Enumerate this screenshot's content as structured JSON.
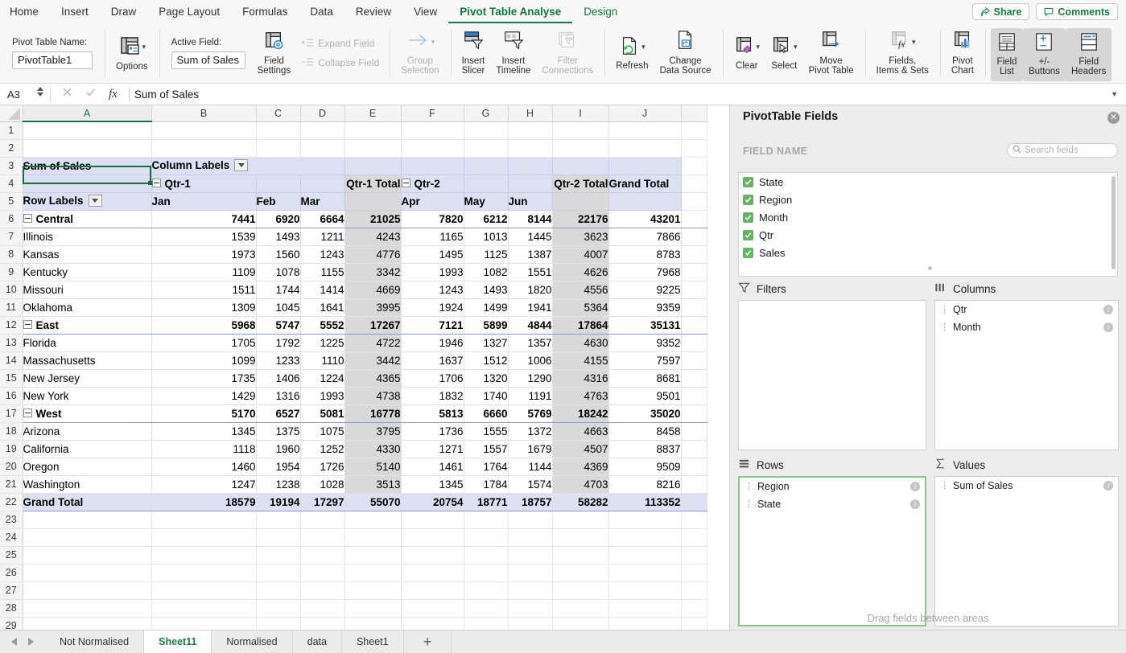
{
  "ribbon": {
    "tabs": [
      {
        "label": "Home",
        "active": false
      },
      {
        "label": "Insert",
        "active": false
      },
      {
        "label": "Draw",
        "active": false
      },
      {
        "label": "Page Layout",
        "active": false
      },
      {
        "label": "Formulas",
        "active": false
      },
      {
        "label": "Data",
        "active": false
      },
      {
        "label": "Review",
        "active": false
      },
      {
        "label": "View",
        "active": false
      },
      {
        "label": "Pivot Table Analyse",
        "active": true
      },
      {
        "label": "Design",
        "active": false
      }
    ],
    "share_label": "Share",
    "comments_label": "Comments",
    "pivot_table_name_label": "Pivot Table Name:",
    "pivot_table_name_value": "PivotTable1",
    "options_label": "Options",
    "active_field_label": "Active Field:",
    "active_field_value": "Sum of Sales",
    "field_settings_label_1": "Field",
    "field_settings_label_2": "Settings",
    "expand_field_label": "Expand Field",
    "collapse_field_label": "Collapse Field",
    "group_selection_label_1": "Group",
    "group_selection_label_2": "Selection",
    "insert_slicer_label_1": "Insert",
    "insert_slicer_label_2": "Slicer",
    "insert_timeline_label_1": "Insert",
    "insert_timeline_label_2": "Timeline",
    "filter_connections_label_1": "Filter",
    "filter_connections_label_2": "Connections",
    "refresh_label": "Refresh",
    "change_data_source_label_1": "Change",
    "change_data_source_label_2": "Data Source",
    "clear_label": "Clear",
    "select_label": "Select",
    "move_pivot_label_1": "Move",
    "move_pivot_label_2": "Pivot Table",
    "fields_items_sets_label_1": "Fields,",
    "fields_items_sets_label_2": "Items & Sets",
    "pivot_chart_label_1": "Pivot",
    "pivot_chart_label_2": "Chart",
    "field_list_label_1": "Field",
    "field_list_label_2": "List",
    "plusminus_label_1": "+/-",
    "plusminus_label_2": "Buttons",
    "field_headers_label_1": "Field",
    "field_headers_label_2": "Headers"
  },
  "formula_bar": {
    "name_box": "A3",
    "value": "Sum of Sales",
    "fx": "fx"
  },
  "grid": {
    "column_headers": [
      "A",
      "B",
      "C",
      "D",
      "E",
      "F",
      "G",
      "H",
      "I",
      "J",
      ""
    ],
    "selected_column": "A",
    "row_numbers": [
      "1",
      "2",
      "3",
      "4",
      "5",
      "6",
      "7",
      "8",
      "9",
      "10",
      "11",
      "12",
      "13",
      "14",
      "15",
      "16",
      "17",
      "18",
      "19",
      "20",
      "21",
      "22",
      "23",
      "24",
      "25",
      "26",
      "27",
      "28",
      "29"
    ],
    "labels": {
      "sum_of_sales": "Sum of Sales",
      "column_labels": "Column Labels",
      "row_labels": "Row Labels",
      "qtr1": "Qtr-1",
      "qtr2": "Qtr-2",
      "qtr1_total": "Qtr-1 Total",
      "qtr2_total": "Qtr-2 Total",
      "grand_total": "Grand Total",
      "months": [
        "Jan",
        "Feb",
        "Mar",
        "Apr",
        "May",
        "Jun"
      ]
    },
    "rows": [
      {
        "row": "6",
        "label": "Central",
        "level": 0,
        "bold": true,
        "q1": [
          7441,
          6920,
          6664
        ],
        "q1t": 21025,
        "q2": [
          7820,
          6212,
          8144
        ],
        "q2t": 22176,
        "gt": 43201
      },
      {
        "row": "7",
        "label": "Illinois",
        "level": 1,
        "bold": false,
        "q1": [
          1539,
          1493,
          1211
        ],
        "q1t": 4243,
        "q2": [
          1165,
          1013,
          1445
        ],
        "q2t": 3623,
        "gt": 7866
      },
      {
        "row": "8",
        "label": "Kansas",
        "level": 1,
        "bold": false,
        "q1": [
          1973,
          1560,
          1243
        ],
        "q1t": 4776,
        "q2": [
          1495,
          1125,
          1387
        ],
        "q2t": 4007,
        "gt": 8783
      },
      {
        "row": "9",
        "label": "Kentucky",
        "level": 1,
        "bold": false,
        "q1": [
          1109,
          1078,
          1155
        ],
        "q1t": 3342,
        "q2": [
          1993,
          1082,
          1551
        ],
        "q2t": 4626,
        "gt": 7968
      },
      {
        "row": "10",
        "label": "Missouri",
        "level": 1,
        "bold": false,
        "q1": [
          1511,
          1744,
          1414
        ],
        "q1t": 4669,
        "q2": [
          1243,
          1493,
          1820
        ],
        "q2t": 4556,
        "gt": 9225
      },
      {
        "row": "11",
        "label": "Oklahoma",
        "level": 1,
        "bold": false,
        "q1": [
          1309,
          1045,
          1641
        ],
        "q1t": 3995,
        "q2": [
          1924,
          1499,
          1941
        ],
        "q2t": 5364,
        "gt": 9359
      },
      {
        "row": "12",
        "label": "East",
        "level": 0,
        "bold": true,
        "q1": [
          5968,
          5747,
          5552
        ],
        "q1t": 17267,
        "q2": [
          7121,
          5899,
          4844
        ],
        "q2t": 17864,
        "gt": 35131
      },
      {
        "row": "13",
        "label": "Florida",
        "level": 1,
        "bold": false,
        "q1": [
          1705,
          1792,
          1225
        ],
        "q1t": 4722,
        "q2": [
          1946,
          1327,
          1357
        ],
        "q2t": 4630,
        "gt": 9352
      },
      {
        "row": "14",
        "label": "Massachusetts",
        "level": 1,
        "bold": false,
        "q1": [
          1099,
          1233,
          1110
        ],
        "q1t": 3442,
        "q2": [
          1637,
          1512,
          1006
        ],
        "q2t": 4155,
        "gt": 7597
      },
      {
        "row": "15",
        "label": "New Jersey",
        "level": 1,
        "bold": false,
        "q1": [
          1735,
          1406,
          1224
        ],
        "q1t": 4365,
        "q2": [
          1706,
          1320,
          1290
        ],
        "q2t": 4316,
        "gt": 8681
      },
      {
        "row": "16",
        "label": "New York",
        "level": 1,
        "bold": false,
        "q1": [
          1429,
          1316,
          1993
        ],
        "q1t": 4738,
        "q2": [
          1832,
          1740,
          1191
        ],
        "q2t": 4763,
        "gt": 9501
      },
      {
        "row": "17",
        "label": "West",
        "level": 0,
        "bold": true,
        "q1": [
          5170,
          6527,
          5081
        ],
        "q1t": 16778,
        "q2": [
          5813,
          6660,
          5769
        ],
        "q2t": 18242,
        "gt": 35020
      },
      {
        "row": "18",
        "label": "Arizona",
        "level": 1,
        "bold": false,
        "q1": [
          1345,
          1375,
          1075
        ],
        "q1t": 3795,
        "q2": [
          1736,
          1555,
          1372
        ],
        "q2t": 4663,
        "gt": 8458
      },
      {
        "row": "19",
        "label": "California",
        "level": 1,
        "bold": false,
        "q1": [
          1118,
          1960,
          1252
        ],
        "q1t": 4330,
        "q2": [
          1271,
          1557,
          1679
        ],
        "q2t": 4507,
        "gt": 8837
      },
      {
        "row": "20",
        "label": "Oregon",
        "level": 1,
        "bold": false,
        "q1": [
          1460,
          1954,
          1726
        ],
        "q1t": 5140,
        "q2": [
          1461,
          1764,
          1144
        ],
        "q2t": 4369,
        "gt": 9509
      },
      {
        "row": "21",
        "label": "Washington",
        "level": 1,
        "bold": false,
        "q1": [
          1247,
          1238,
          1028
        ],
        "q1t": 3513,
        "q2": [
          1345,
          1784,
          1574
        ],
        "q2t": 4703,
        "gt": 8216
      }
    ],
    "grand_total_row": {
      "row": "22",
      "label": "Grand Total",
      "q1": [
        18579,
        19194,
        17297
      ],
      "q1t": 55070,
      "q2": [
        20754,
        18771,
        18757
      ],
      "q2t": 58282,
      "gt": 113352
    },
    "empty_rows": [
      "23",
      "24",
      "25",
      "26",
      "27",
      "28",
      "29"
    ]
  },
  "fields_panel": {
    "title": "PivotTable Fields",
    "field_name_header": "FIELD NAME",
    "search_placeholder": "Search fields",
    "fields": [
      {
        "label": "State",
        "checked": true
      },
      {
        "label": "Region",
        "checked": true
      },
      {
        "label": "Month",
        "checked": true
      },
      {
        "label": "Qtr",
        "checked": true
      },
      {
        "label": "Sales",
        "checked": true
      }
    ],
    "zones": {
      "filters": {
        "title": "Filters",
        "items": []
      },
      "columns": {
        "title": "Columns",
        "items": [
          "Qtr",
          "Month"
        ]
      },
      "rows": {
        "title": "Rows",
        "items": [
          "Region",
          "State"
        ],
        "highlighted": true
      },
      "values": {
        "title": "Values",
        "items": [
          "Sum of Sales"
        ]
      }
    },
    "drag_hint": "Drag fields between areas"
  },
  "sheet_tabs": {
    "tabs": [
      {
        "label": "Not Normalised",
        "active": false
      },
      {
        "label": "Sheet11",
        "active": true
      },
      {
        "label": "Normalised",
        "active": false
      },
      {
        "label": "data",
        "active": false
      },
      {
        "label": "Sheet1",
        "active": false
      }
    ],
    "add_label": "+"
  },
  "colors": {
    "accent_green": "#1a7a42",
    "header_blue": "#dce0f2",
    "shade_gray": "#d9d9d9",
    "checkbox_green": "#62b563"
  }
}
